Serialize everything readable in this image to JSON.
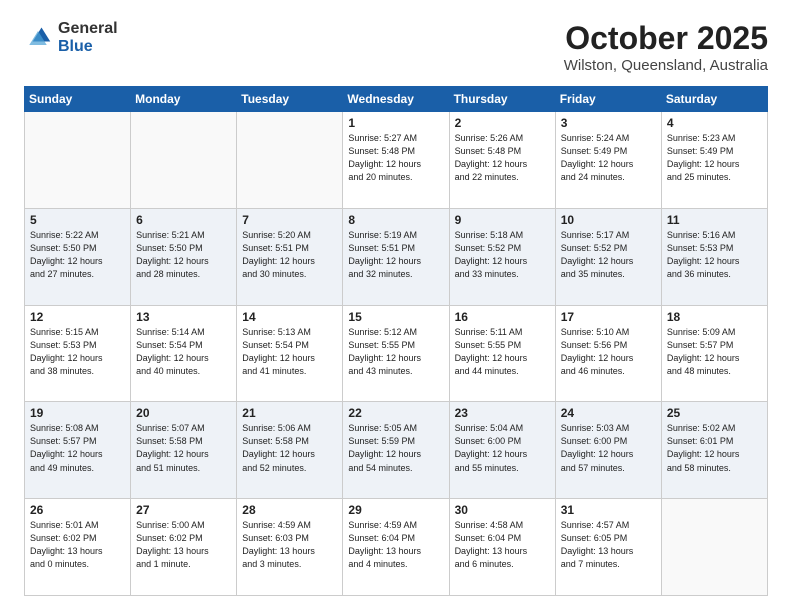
{
  "header": {
    "logo_general": "General",
    "logo_blue": "Blue",
    "title": "October 2025",
    "location": "Wilston, Queensland, Australia"
  },
  "calendar": {
    "days_of_week": [
      "Sunday",
      "Monday",
      "Tuesday",
      "Wednesday",
      "Thursday",
      "Friday",
      "Saturday"
    ],
    "weeks": [
      [
        {
          "day": "",
          "info": ""
        },
        {
          "day": "",
          "info": ""
        },
        {
          "day": "",
          "info": ""
        },
        {
          "day": "1",
          "info": "Sunrise: 5:27 AM\nSunset: 5:48 PM\nDaylight: 12 hours\nand 20 minutes."
        },
        {
          "day": "2",
          "info": "Sunrise: 5:26 AM\nSunset: 5:48 PM\nDaylight: 12 hours\nand 22 minutes."
        },
        {
          "day": "3",
          "info": "Sunrise: 5:24 AM\nSunset: 5:49 PM\nDaylight: 12 hours\nand 24 minutes."
        },
        {
          "day": "4",
          "info": "Sunrise: 5:23 AM\nSunset: 5:49 PM\nDaylight: 12 hours\nand 25 minutes."
        }
      ],
      [
        {
          "day": "5",
          "info": "Sunrise: 5:22 AM\nSunset: 5:50 PM\nDaylight: 12 hours\nand 27 minutes."
        },
        {
          "day": "6",
          "info": "Sunrise: 5:21 AM\nSunset: 5:50 PM\nDaylight: 12 hours\nand 28 minutes."
        },
        {
          "day": "7",
          "info": "Sunrise: 5:20 AM\nSunset: 5:51 PM\nDaylight: 12 hours\nand 30 minutes."
        },
        {
          "day": "8",
          "info": "Sunrise: 5:19 AM\nSunset: 5:51 PM\nDaylight: 12 hours\nand 32 minutes."
        },
        {
          "day": "9",
          "info": "Sunrise: 5:18 AM\nSunset: 5:52 PM\nDaylight: 12 hours\nand 33 minutes."
        },
        {
          "day": "10",
          "info": "Sunrise: 5:17 AM\nSunset: 5:52 PM\nDaylight: 12 hours\nand 35 minutes."
        },
        {
          "day": "11",
          "info": "Sunrise: 5:16 AM\nSunset: 5:53 PM\nDaylight: 12 hours\nand 36 minutes."
        }
      ],
      [
        {
          "day": "12",
          "info": "Sunrise: 5:15 AM\nSunset: 5:53 PM\nDaylight: 12 hours\nand 38 minutes."
        },
        {
          "day": "13",
          "info": "Sunrise: 5:14 AM\nSunset: 5:54 PM\nDaylight: 12 hours\nand 40 minutes."
        },
        {
          "day": "14",
          "info": "Sunrise: 5:13 AM\nSunset: 5:54 PM\nDaylight: 12 hours\nand 41 minutes."
        },
        {
          "day": "15",
          "info": "Sunrise: 5:12 AM\nSunset: 5:55 PM\nDaylight: 12 hours\nand 43 minutes."
        },
        {
          "day": "16",
          "info": "Sunrise: 5:11 AM\nSunset: 5:55 PM\nDaylight: 12 hours\nand 44 minutes."
        },
        {
          "day": "17",
          "info": "Sunrise: 5:10 AM\nSunset: 5:56 PM\nDaylight: 12 hours\nand 46 minutes."
        },
        {
          "day": "18",
          "info": "Sunrise: 5:09 AM\nSunset: 5:57 PM\nDaylight: 12 hours\nand 48 minutes."
        }
      ],
      [
        {
          "day": "19",
          "info": "Sunrise: 5:08 AM\nSunset: 5:57 PM\nDaylight: 12 hours\nand 49 minutes."
        },
        {
          "day": "20",
          "info": "Sunrise: 5:07 AM\nSunset: 5:58 PM\nDaylight: 12 hours\nand 51 minutes."
        },
        {
          "day": "21",
          "info": "Sunrise: 5:06 AM\nSunset: 5:58 PM\nDaylight: 12 hours\nand 52 minutes."
        },
        {
          "day": "22",
          "info": "Sunrise: 5:05 AM\nSunset: 5:59 PM\nDaylight: 12 hours\nand 54 minutes."
        },
        {
          "day": "23",
          "info": "Sunrise: 5:04 AM\nSunset: 6:00 PM\nDaylight: 12 hours\nand 55 minutes."
        },
        {
          "day": "24",
          "info": "Sunrise: 5:03 AM\nSunset: 6:00 PM\nDaylight: 12 hours\nand 57 minutes."
        },
        {
          "day": "25",
          "info": "Sunrise: 5:02 AM\nSunset: 6:01 PM\nDaylight: 12 hours\nand 58 minutes."
        }
      ],
      [
        {
          "day": "26",
          "info": "Sunrise: 5:01 AM\nSunset: 6:02 PM\nDaylight: 13 hours\nand 0 minutes."
        },
        {
          "day": "27",
          "info": "Sunrise: 5:00 AM\nSunset: 6:02 PM\nDaylight: 13 hours\nand 1 minute."
        },
        {
          "day": "28",
          "info": "Sunrise: 4:59 AM\nSunset: 6:03 PM\nDaylight: 13 hours\nand 3 minutes."
        },
        {
          "day": "29",
          "info": "Sunrise: 4:59 AM\nSunset: 6:04 PM\nDaylight: 13 hours\nand 4 minutes."
        },
        {
          "day": "30",
          "info": "Sunrise: 4:58 AM\nSunset: 6:04 PM\nDaylight: 13 hours\nand 6 minutes."
        },
        {
          "day": "31",
          "info": "Sunrise: 4:57 AM\nSunset: 6:05 PM\nDaylight: 13 hours\nand 7 minutes."
        },
        {
          "day": "",
          "info": ""
        }
      ]
    ]
  }
}
